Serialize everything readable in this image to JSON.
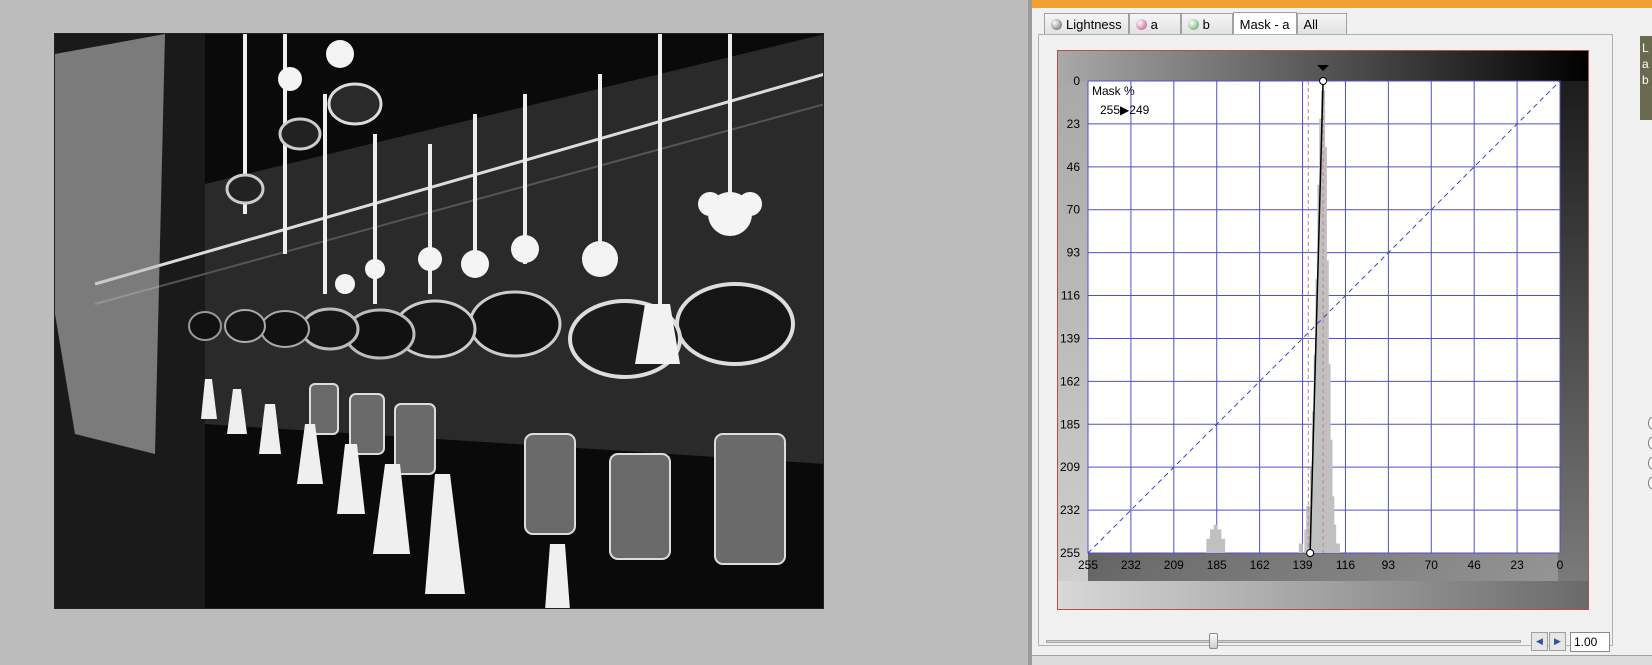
{
  "tabs": [
    {
      "label": "Lightness",
      "icon": "lightness-icon",
      "color": "#555555",
      "active": false
    },
    {
      "label": "a",
      "icon": "a-channel-icon",
      "color": "#c04080",
      "active": false
    },
    {
      "label": "b",
      "icon": "b-channel-icon",
      "color": "#50a050",
      "active": false
    },
    {
      "label": "Mask - a",
      "icon": "",
      "color": "",
      "active": true
    },
    {
      "label": "All",
      "icon": "",
      "color": "",
      "active": false
    }
  ],
  "curve_editor": {
    "mask_label": "Mask %",
    "mask_from": "255",
    "mask_arrow": "▶",
    "mask_to": "249",
    "y_ticks": [
      "0",
      "23",
      "46",
      "70",
      "93",
      "116",
      "139",
      "162",
      "185",
      "209",
      "232",
      "255"
    ],
    "x_ticks": [
      "255",
      "232",
      "209",
      "185",
      "162",
      "139",
      "116",
      "93",
      "70",
      "46",
      "23",
      "0"
    ]
  },
  "chart_data": {
    "type": "line",
    "x_axis": {
      "min": 255,
      "max": 0,
      "reversed": true
    },
    "y_axis": {
      "min": 0,
      "max": 255,
      "reversed": true
    },
    "grid": true,
    "curve": {
      "points": [
        [
          135,
          255
        ],
        [
          128,
          0
        ]
      ],
      "color": "#000000"
    },
    "identity_line": {
      "points": [
        [
          255,
          255
        ],
        [
          0,
          0
        ]
      ],
      "color": "#4040c0",
      "style": "dashed"
    },
    "guide_lines": [
      {
        "x": 136,
        "color": "#d08080",
        "style": "dashed"
      },
      {
        "x": 128,
        "color": "#d08080",
        "style": "dashed"
      }
    ],
    "histogram": {
      "color": "#c0c0c0",
      "bins": [
        {
          "x": 190,
          "level": 0.03
        },
        {
          "x": 188,
          "level": 0.05
        },
        {
          "x": 186,
          "level": 0.06
        },
        {
          "x": 184,
          "level": 0.05
        },
        {
          "x": 182,
          "level": 0.03
        },
        {
          "x": 140,
          "level": 0.02
        },
        {
          "x": 137,
          "level": 0.05
        },
        {
          "x": 136,
          "level": 0.1
        },
        {
          "x": 134,
          "level": 0.18
        },
        {
          "x": 133,
          "level": 0.3
        },
        {
          "x": 132,
          "level": 0.42
        },
        {
          "x": 131,
          "level": 0.58
        },
        {
          "x": 130,
          "level": 0.78
        },
        {
          "x": 129,
          "level": 0.92
        },
        {
          "x": 128,
          "level": 0.98
        },
        {
          "x": 127,
          "level": 0.86
        },
        {
          "x": 126,
          "level": 0.62
        },
        {
          "x": 125,
          "level": 0.4
        },
        {
          "x": 124,
          "level": 0.24
        },
        {
          "x": 123,
          "level": 0.12
        },
        {
          "x": 122,
          "level": 0.06
        },
        {
          "x": 120,
          "level": 0.02
        }
      ]
    }
  },
  "slider": {
    "value": 0.33,
    "zoom_value": "1.00"
  },
  "info_tag": {
    "lines": [
      "L",
      "a",
      "b"
    ]
  },
  "colors": {
    "accent_orange": "#f0a030",
    "grid_blue": "#5050c8",
    "frame_red": "#b05050"
  }
}
